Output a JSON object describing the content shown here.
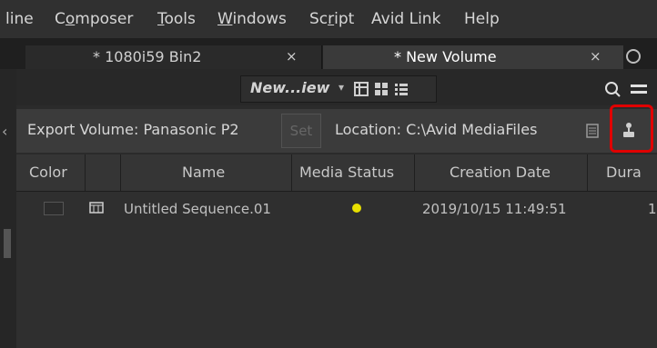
{
  "menu": {
    "items": [
      {
        "label": "line",
        "underline_index": -1
      },
      {
        "label": "Composer",
        "underline_index": 1
      },
      {
        "label": "Tools",
        "underline_index": 0
      },
      {
        "label": "Windows",
        "underline_index": 0
      },
      {
        "label": "Script",
        "underline_index": 2
      },
      {
        "label": "Avid Link",
        "underline_index": -1
      },
      {
        "label": "Help",
        "underline_index": -1
      }
    ]
  },
  "tabs": {
    "inactive": {
      "label": "* 1080i59 Bin2",
      "close": "×"
    },
    "active": {
      "label": "* New Volume",
      "close": "×"
    }
  },
  "toolbar": {
    "view_name": "New...iew",
    "view_dropdown_glyph": "▾",
    "search_icon": "search-icon",
    "menu_icon": "hamburger-icon"
  },
  "export": {
    "volume_label": "Export Volume: Panasonic P2",
    "set_label": "Set",
    "location_label": "Location: C:\\Avid MediaFiles"
  },
  "table": {
    "headers": [
      "Color",
      "",
      "Name",
      "Media Status",
      "Creation Date",
      "Dura"
    ],
    "rows": [
      {
        "color": "",
        "icon": "sequence-icon",
        "name": "Untitled Sequence.01",
        "media_status_color": "#e8e000",
        "creation_date": "2019/10/15 11:49:51",
        "duration": "1"
      }
    ]
  },
  "colors": {
    "highlight": "#e00000",
    "status_dot": "#e8e000"
  }
}
